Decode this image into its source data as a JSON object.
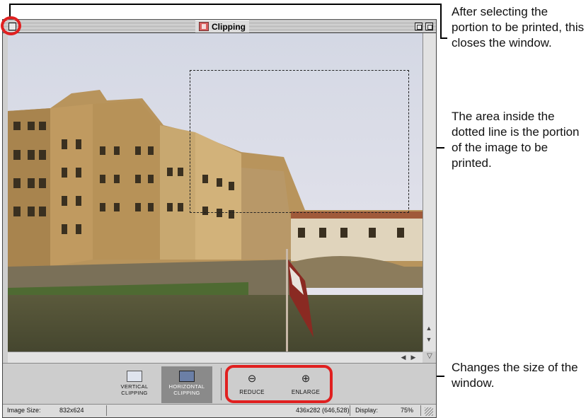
{
  "window": {
    "title": "Clipping"
  },
  "toolbar": {
    "vertical_clipping": "VERTICAL\nCLIPPING",
    "horizontal_clipping": "HORIZONTAL\nCLIPPING",
    "reduce": "REDUCE",
    "enlarge": "ENLARGE",
    "active_tool": "horizontal_clipping"
  },
  "statusbar": {
    "image_size_label": "Image Size:",
    "image_size_value": "832x624",
    "selection_info": "436x282 (646,528)",
    "display_label": "Display:",
    "display_value": "75%"
  },
  "callouts": {
    "close": "After selecting the portion to be printed, this closes the window.",
    "dotted": "The area inside the dotted line is the portion of the image to be printed.",
    "size": "Changes the size of the window."
  },
  "colors": {
    "highlight": "#e02020",
    "title_icon": "#d86060",
    "active_tool_bg": "#8a8a8a"
  },
  "icons": {
    "close_box": "close-box-icon",
    "zoom_box": "zoom-box-icon",
    "collapse_box": "collapse-box-icon",
    "reduce": "magnifier-minus-icon",
    "enlarge": "magnifier-plus-icon",
    "vertical_clipping": "vertical-clip-icon",
    "horizontal_clipping": "horizontal-clip-icon"
  }
}
